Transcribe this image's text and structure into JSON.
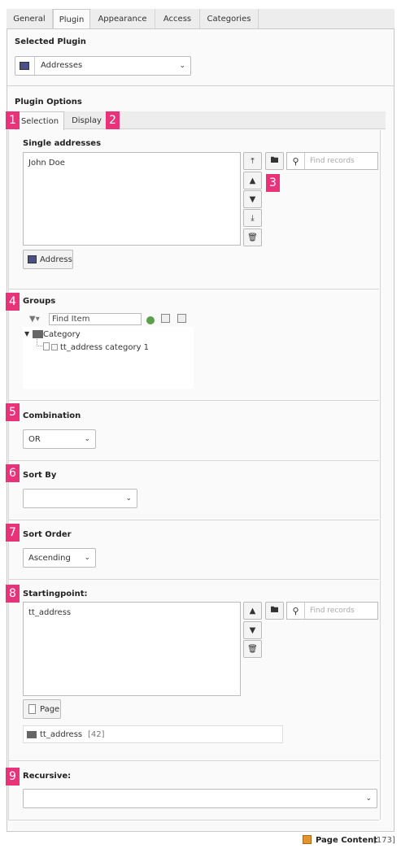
{
  "tabs": [
    "General",
    "Plugin",
    "Appearance",
    "Access",
    "Categories"
  ],
  "selected_plugin": {
    "label": "Selected Plugin",
    "value": "Addresses"
  },
  "plugin_options": {
    "label": "Plugin Options",
    "subtabs": [
      "Selection",
      "Display"
    ]
  },
  "badges": [
    "1",
    "2",
    "3",
    "4",
    "5",
    "6",
    "7",
    "8",
    "9"
  ],
  "single_addresses": {
    "label": "Single addresses",
    "items": [
      "John Doe"
    ],
    "search_placeholder": "Find records",
    "add_button": "Address"
  },
  "groups": {
    "label": "Groups",
    "filter_placeholder": "Find Item",
    "tree_root": "Category",
    "tree_child": "tt_address category 1"
  },
  "combination": {
    "label": "Combination",
    "value": "OR"
  },
  "sort_by": {
    "label": "Sort By",
    "value": ""
  },
  "sort_order": {
    "label": "Sort Order",
    "value": "Ascending"
  },
  "startingpoint": {
    "label": "Startingpoint:",
    "items": [
      "tt_address"
    ],
    "search_placeholder": "Find records",
    "add_button": "Page",
    "selected_record": "tt_address",
    "selected_record_id": "[42]"
  },
  "recursive": {
    "label": "Recursive:",
    "value": ""
  },
  "footer": {
    "label": "Page Content",
    "id": "[173]"
  }
}
